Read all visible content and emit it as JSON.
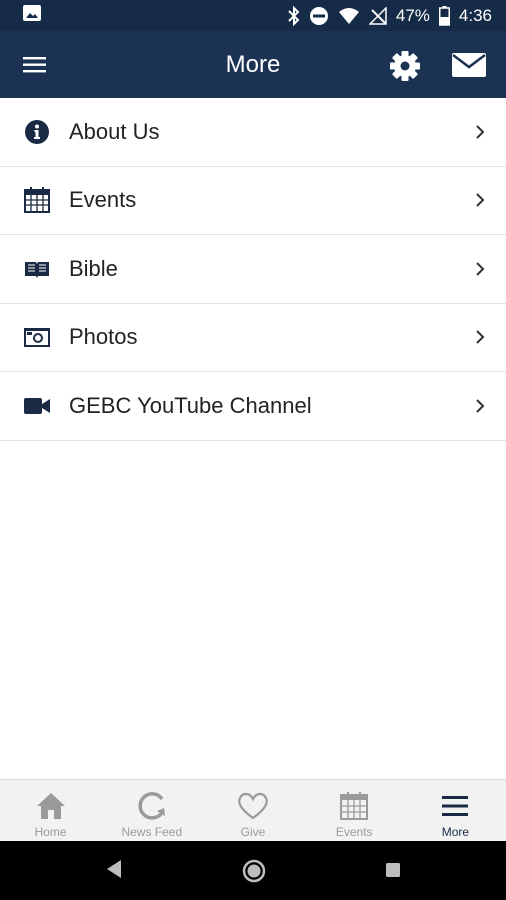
{
  "status_bar": {
    "battery": "47%",
    "time": "4:36"
  },
  "app_bar": {
    "title": "More"
  },
  "menu": {
    "items": [
      {
        "label": "About Us",
        "icon": "info-icon"
      },
      {
        "label": "Events",
        "icon": "calendar-icon"
      },
      {
        "label": "Bible",
        "icon": "bible-icon"
      },
      {
        "label": "Photos",
        "icon": "camera-icon"
      },
      {
        "label": "GEBC YouTube Channel",
        "icon": "video-camera-icon"
      }
    ]
  },
  "bottom_nav": {
    "tabs": [
      {
        "label": "Home",
        "icon": "home-icon"
      },
      {
        "label": "News Feed",
        "icon": "news-feed-icon"
      },
      {
        "label": "Give",
        "icon": "heart-icon"
      },
      {
        "label": "Events",
        "icon": "calendar-icon"
      },
      {
        "label": "More",
        "icon": "hamburger-icon"
      }
    ],
    "active": "More"
  },
  "colors": {
    "header": "#1b3253",
    "status_bar": "#152b47",
    "icon_navy": "#1b2a44",
    "inactive": "#9a9a9a"
  }
}
